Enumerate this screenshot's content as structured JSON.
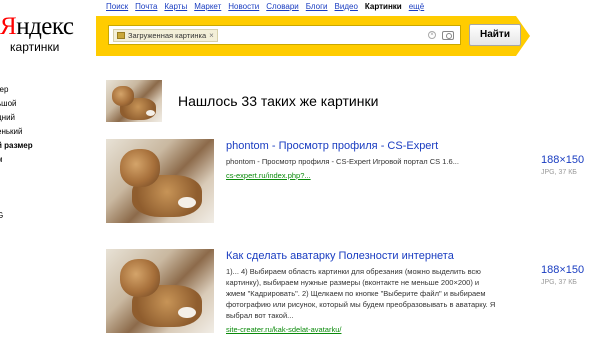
{
  "logo": {
    "brand_ya": "Я",
    "brand_rest": "ндекс",
    "sub": "картинки"
  },
  "nav": {
    "items": [
      "Поиск",
      "Почта",
      "Карты",
      "Маркет",
      "Новости",
      "Словари",
      "Блоги",
      "Видео"
    ],
    "active": "Картинки",
    "more": "ещё"
  },
  "search": {
    "chip_label": "Загруженная картинка",
    "chip_close": "×",
    "value": "",
    "button_label": "Найти"
  },
  "sidebar": {
    "items": [
      {
        "label": "мер",
        "kind": "heading"
      },
      {
        "label": "ьшой",
        "kind": "item"
      },
      {
        "label": "дний",
        "kind": "item"
      },
      {
        "label": "енький",
        "kind": "item"
      },
      {
        "label": "й размер",
        "kind": "item"
      },
      {
        "label": "м",
        "kind": "item"
      },
      {
        "label": "",
        "kind": "gap"
      },
      {
        "label": "л",
        "kind": "heading"
      },
      {
        "label": "",
        "kind": "item"
      },
      {
        "label": "G",
        "kind": "item"
      },
      {
        "label": "",
        "kind": "item"
      }
    ]
  },
  "summary": {
    "text": "Нашлось 33 таких же картинки"
  },
  "results": [
    {
      "title": "phontom - Просмотр профиля - CS-Expert",
      "snippet": "phontom - Просмотр профиля - CS-Expert Игровой портал CS 1.6...",
      "url": "cs-expert.ru/index.php?...",
      "size": "188×150",
      "info": "JPG, 37 КБ"
    },
    {
      "title": "Как сделать аватарку Полезности интернета",
      "snippet": "1)... 4) Выбираем область картинки для обрезания (можно выделить всю картинку), выбираем нужные размеры (вконтакте не меньше 200×200) и жмем \"Кадрировать\". 2) Щелкаем по кнопке \"Выберите файл\" и выбираем фотографию или рисунок, который мы будем преобразовывать в аватарку. Я выбрал вот такой...",
      "url": "site-creater.ru/kak-sdelat-avatarku/",
      "size": "188×150",
      "info": "JPG, 37 КБ"
    }
  ],
  "colors": {
    "accent_yellow": "#ffcc00",
    "link_blue": "#1a3dc1",
    "url_green": "#0a8a0a",
    "logo_red": "#ff0000"
  }
}
